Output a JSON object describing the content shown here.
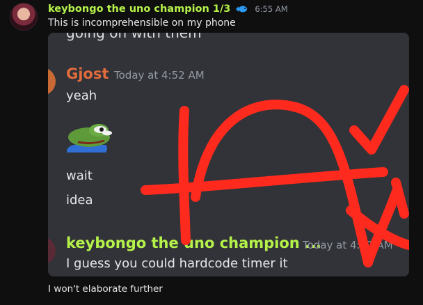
{
  "message1": {
    "author": "keybongo the uno champion 1/3",
    "timestamp": "6:55 AM",
    "text": "This is incomprehensible on my phone"
  },
  "screenshot": {
    "cut_off_text": "going on with them",
    "msg_gjost": {
      "author": "Gjost",
      "timestamp": "Today at 4:52 AM",
      "lines": [
        "yeah",
        "wait",
        "idea"
      ]
    },
    "msg_keybongo": {
      "author": "keybongo the uno champion ...",
      "timestamp": "Today at 4:52 AM",
      "text": "I guess you could hardcode timer it"
    }
  },
  "message2": {
    "text": "I won't elaborate further"
  },
  "colors": {
    "background": "#0f0f10",
    "author_green": "#b6f34a",
    "gjost_orange": "#e26c3c",
    "scribble_red": "#ff2a1e"
  }
}
